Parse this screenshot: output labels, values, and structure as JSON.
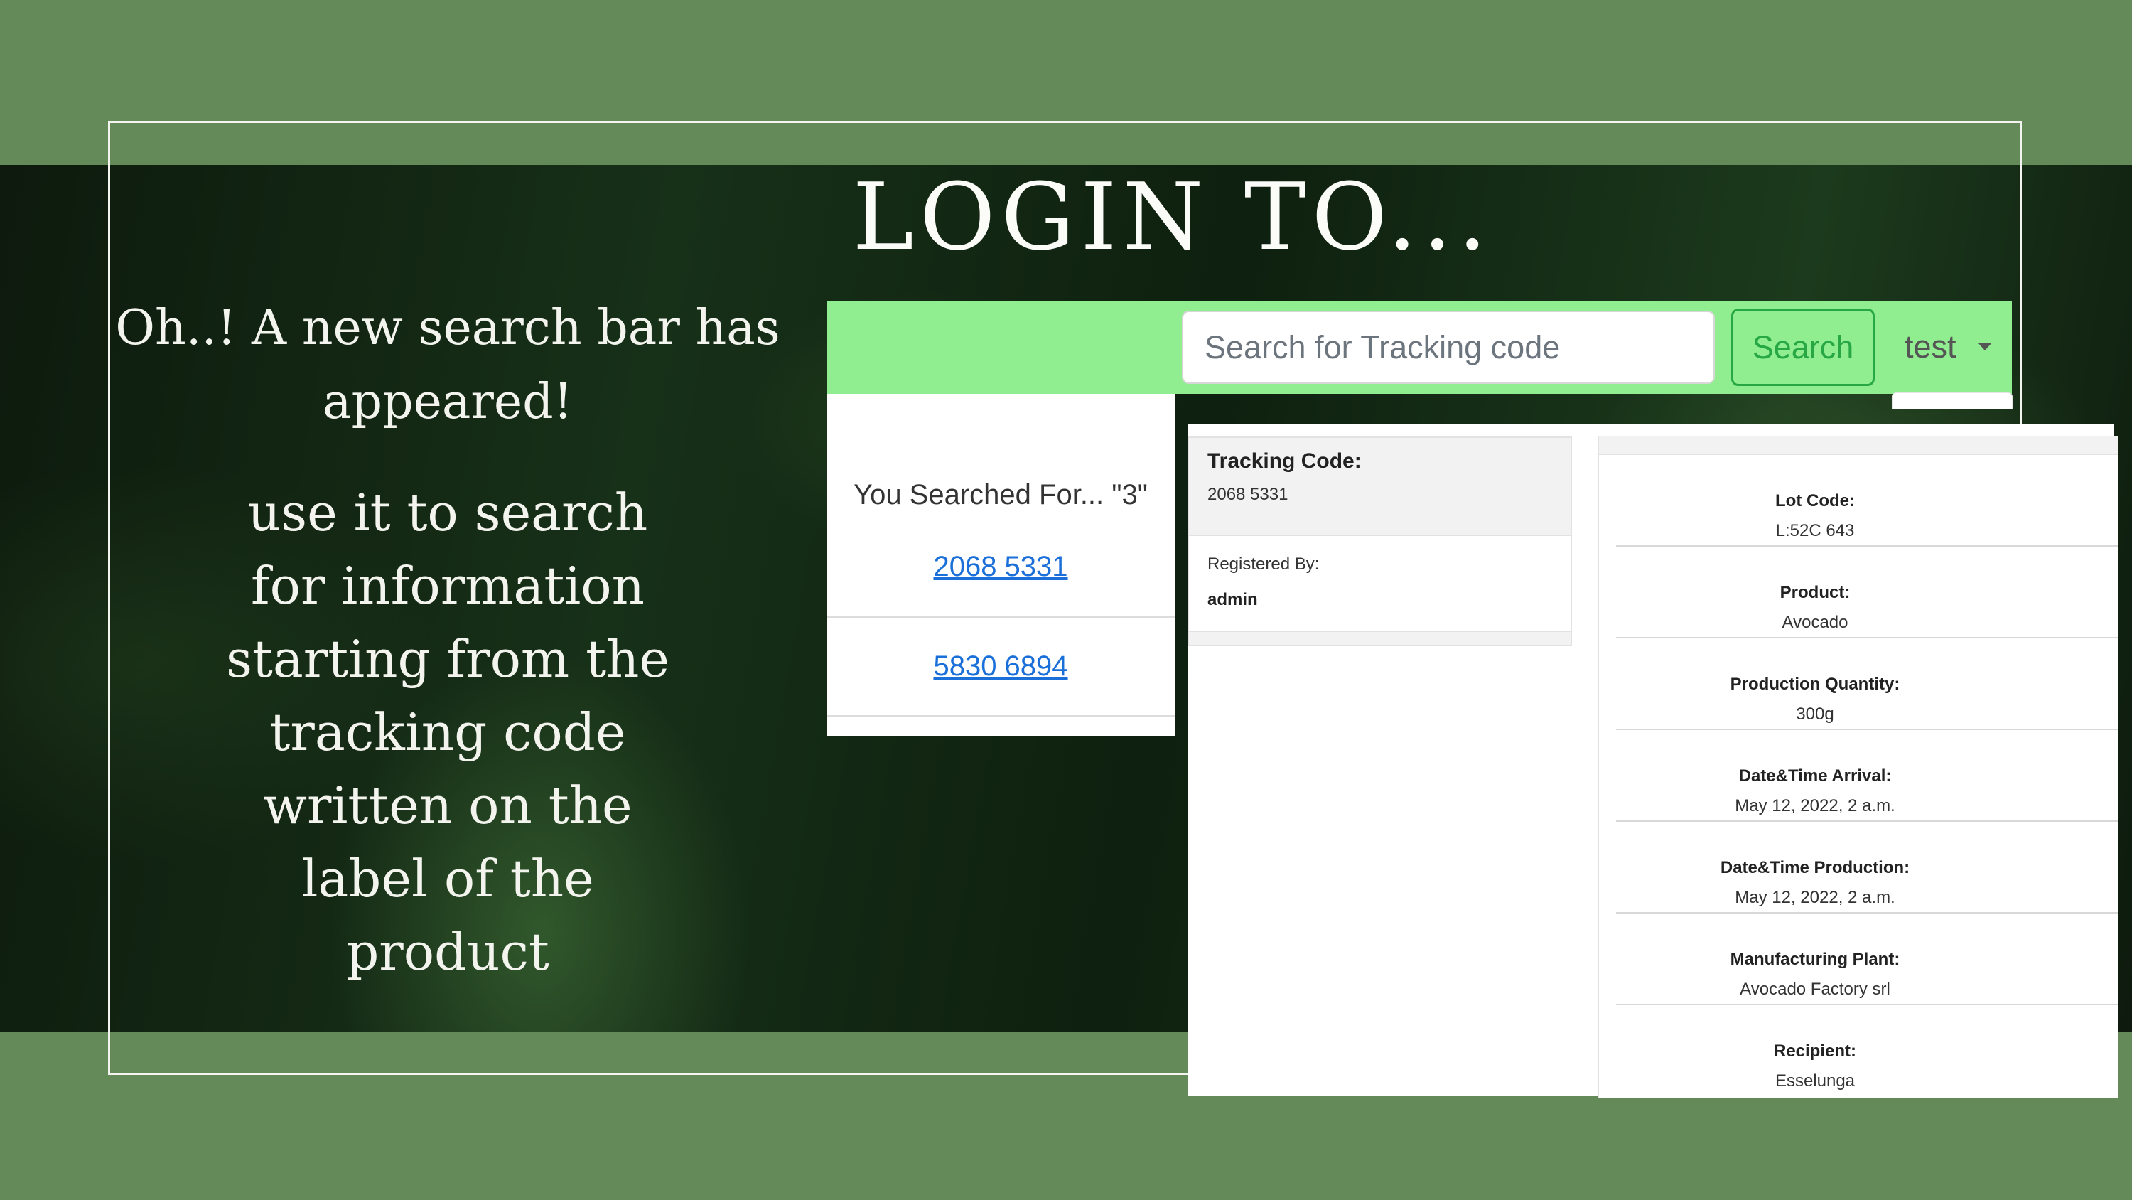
{
  "slide": {
    "title": "LOGIN TO...",
    "lead": "Oh..! A new search bar has appeared!",
    "body": "use it to search for information starting from the tracking code written on the label of the product"
  },
  "navbar": {
    "search_placeholder": "Search for Tracking code",
    "search_button": "Search",
    "user_menu": "test"
  },
  "results": {
    "header": "You Searched For... \"3\"",
    "items": [
      "2068 5331",
      "5830 6894"
    ]
  },
  "detail": {
    "tracking_code_label": "Tracking Code:",
    "tracking_code_value": "2068 5331",
    "registered_by_label": "Registered By:",
    "registered_by_value": "admin",
    "fields": [
      {
        "label": "Lot Code:",
        "value": "L:52C 643"
      },
      {
        "label": "Product:",
        "value": "Avocado"
      },
      {
        "label": "Production Quantity:",
        "value": "300g"
      },
      {
        "label": "Date&Time Arrival:",
        "value": "May 12, 2022, 2 a.m."
      },
      {
        "label": "Date&Time Production:",
        "value": "May 12, 2022, 2 a.m."
      },
      {
        "label": "Manufacturing Plant:",
        "value": "Avocado Factory srl"
      },
      {
        "label": "Recipient:",
        "value": "Esselunga"
      }
    ]
  },
  "colors": {
    "slide_green": "#658a5a",
    "navbar_green": "#90ee90",
    "button_green": "#28a745",
    "link_blue": "#1a6fd8"
  }
}
